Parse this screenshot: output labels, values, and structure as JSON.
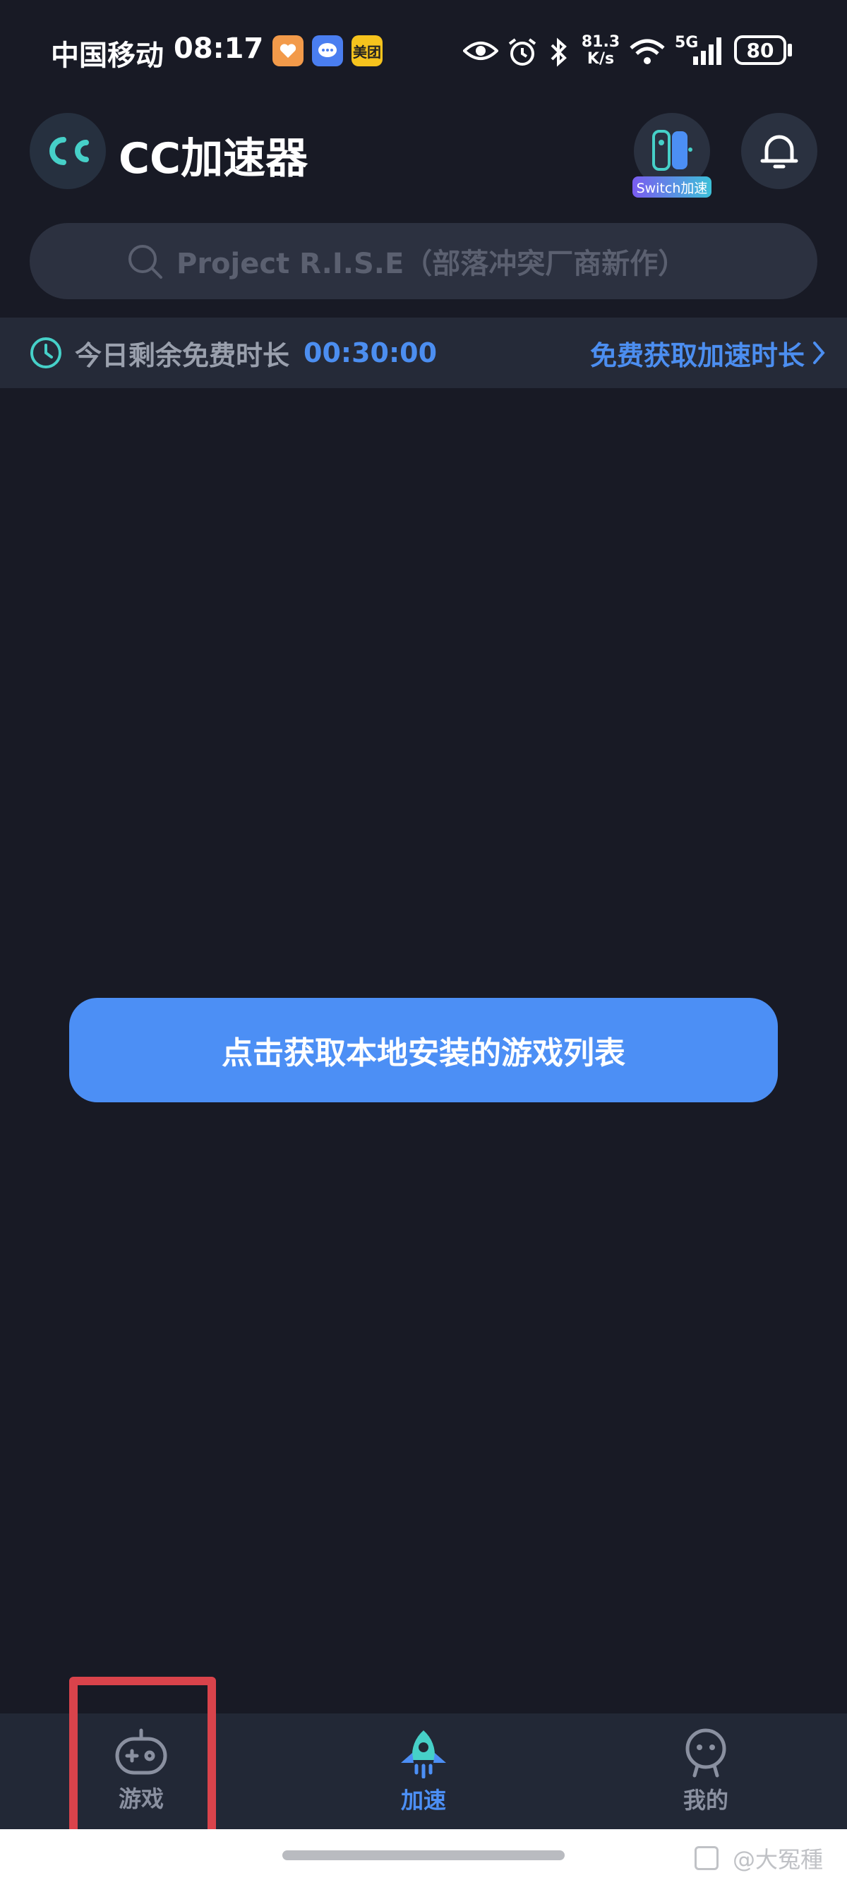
{
  "status_bar": {
    "carrier": "中国移动",
    "time": "08:17",
    "apps": [
      "like-app",
      "message-app",
      "美团"
    ],
    "net_speed_top": "81.3",
    "net_speed_bottom": "K/s",
    "signal": "5G",
    "battery": "80"
  },
  "header": {
    "title": "CC加速器",
    "switch_label": "Switch加速"
  },
  "search": {
    "placeholder": "Project R.I.S.E（部落冲突厂商新作）"
  },
  "free_time": {
    "label": "今日剩余免费时长",
    "time": "00:30:00",
    "link": "免费获取加速时长"
  },
  "main": {
    "button_label": "点击获取本地安装的游戏列表"
  },
  "nav": {
    "items": [
      {
        "label": "游戏",
        "icon": "gamepad-icon",
        "active": false
      },
      {
        "label": "加速",
        "icon": "rocket-icon",
        "active": true
      },
      {
        "label": "我的",
        "icon": "profile-icon",
        "active": false
      }
    ]
  },
  "watermark": "@大冤種",
  "colors": {
    "background": "#181a25",
    "accent": "#4c8ff5",
    "highlight": "#d9434b"
  }
}
